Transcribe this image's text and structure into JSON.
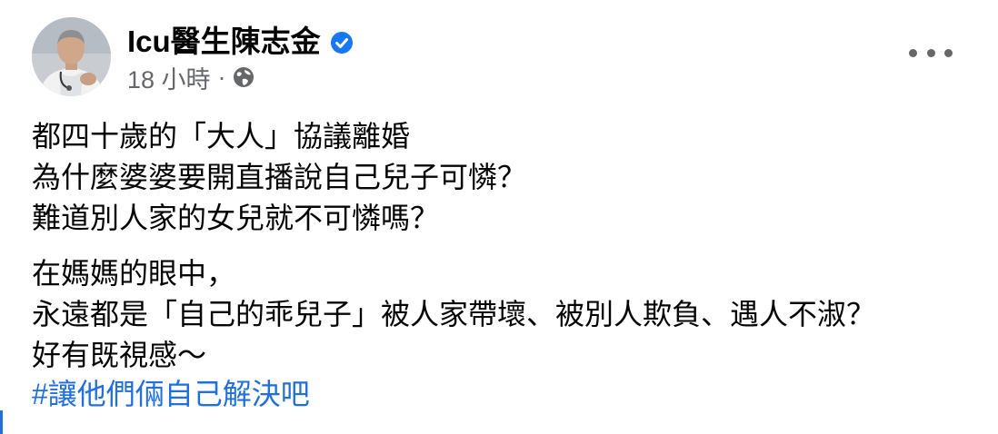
{
  "post": {
    "author_name": "Icu醫生陳志金",
    "timestamp": "18 小時",
    "separator": "·",
    "privacy_icon": "globe-icon",
    "verified_icon": "verified-badge-icon",
    "more_icon": "more-options-icon",
    "paragraphs": [
      {
        "lines": [
          "都四十歲的「大人」協議離婚",
          "為什麼婆婆要開直播說自己兒子可憐？",
          "難道別人家的女兒就不可憐嗎？"
        ]
      },
      {
        "lines": [
          "在媽媽的眼中，",
          "永遠都是「自己的乖兒子」被人家帶壞、被別人欺負、遇人不淑？",
          "好有既視感～"
        ]
      }
    ],
    "hashtag": "#讓他們倆自己解決吧"
  },
  "colors": {
    "text": "#050505",
    "secondary": "#65676b",
    "link": "#216fdb",
    "verified": "#1877f2"
  }
}
